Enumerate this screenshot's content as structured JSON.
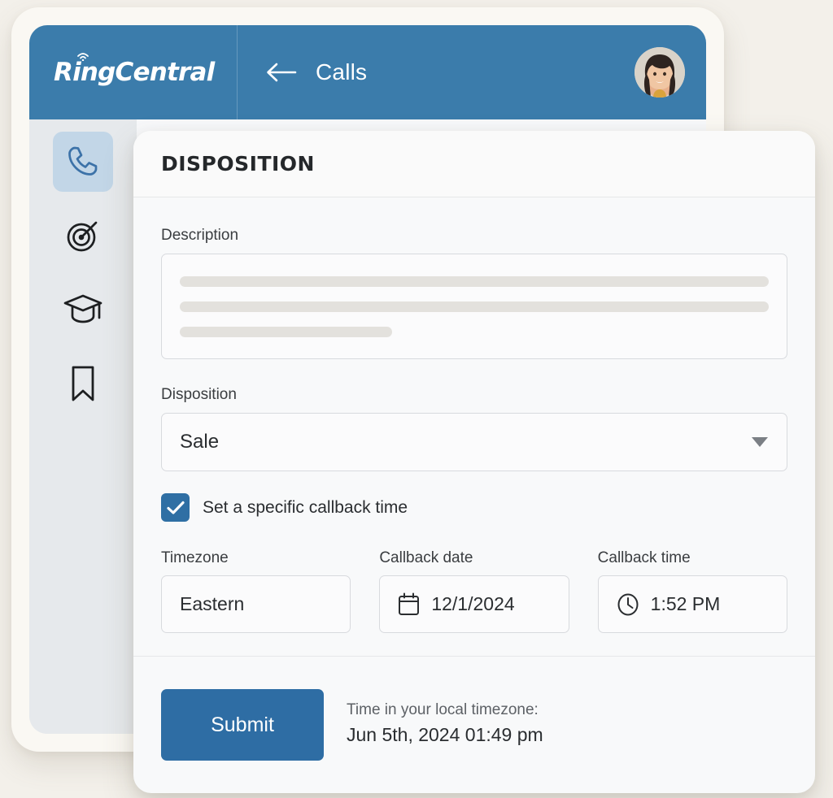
{
  "app": {
    "brand": "RingCentral",
    "brand_logo_icon": "wifi-signal-icon",
    "header_title": "Calls",
    "back_icon": "arrow-left-icon",
    "avatar_icon": "user-avatar-photo",
    "header_color": "#3b7cab"
  },
  "sidebar": {
    "items": [
      {
        "icon": "phone-icon",
        "name": "calls",
        "active": true
      },
      {
        "icon": "target-icon",
        "name": "goals",
        "active": false
      },
      {
        "icon": "graduation-cap-icon",
        "name": "learning",
        "active": false
      },
      {
        "icon": "bookmark-icon",
        "name": "saved",
        "active": false
      }
    ],
    "active_tile_color": "#c2d6e7",
    "background_color": "#e6e9ec"
  },
  "panel": {
    "title": "DISPOSITION",
    "description": {
      "label": "Description",
      "value": "",
      "skeleton_widths": [
        "100%",
        "100%",
        "36%"
      ]
    },
    "disposition": {
      "label": "Disposition",
      "value": "Sale",
      "caret_icon": "chevron-down-icon"
    },
    "callback_checkbox": {
      "label": "Set a specific callback time",
      "checked": true,
      "check_icon": "checkmark-icon",
      "color": "#2f6fa4"
    },
    "timezone": {
      "label": "Timezone",
      "value": "Eastern"
    },
    "callback_date": {
      "label": "Callback date",
      "value": "12/1/2024",
      "icon": "calendar-icon"
    },
    "callback_time": {
      "label": "Callback time",
      "value": "1:52 PM",
      "icon": "clock-icon"
    }
  },
  "footer": {
    "submit_label": "Submit",
    "submit_color": "#2e6da4",
    "local_time_label": "Time in your local timezone:",
    "local_time_value": "Jun 5th, 2024 01:49 pm"
  }
}
